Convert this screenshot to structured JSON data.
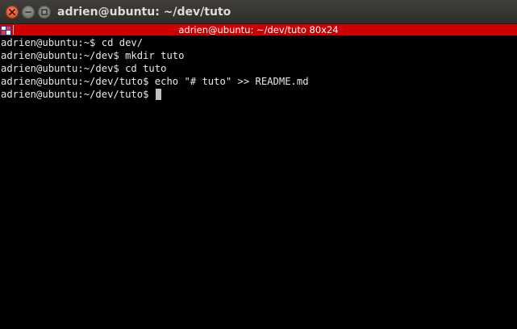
{
  "window": {
    "title": "adrien@ubuntu: ~/dev/tuto",
    "controls": {
      "close_icon": "close-icon",
      "minimize_icon": "minimize-icon",
      "maximize_icon": "maximize-icon"
    }
  },
  "tab": {
    "icon": "terminal-tab-icon",
    "title": "adrien@ubuntu: ~/dev/tuto 80x24",
    "color": "#cc0000"
  },
  "terminal": {
    "lines": [
      "adrien@ubuntu:~$ cd dev/",
      "adrien@ubuntu:~/dev$ mkdir tuto",
      "adrien@ubuntu:~/dev$ cd tuto",
      "adrien@ubuntu:~/dev/tuto$ echo \"# tuto\" >> README.md",
      "adrien@ubuntu:~/dev/tuto$ "
    ],
    "background": "#000000",
    "foreground": "#e8e8e8"
  }
}
